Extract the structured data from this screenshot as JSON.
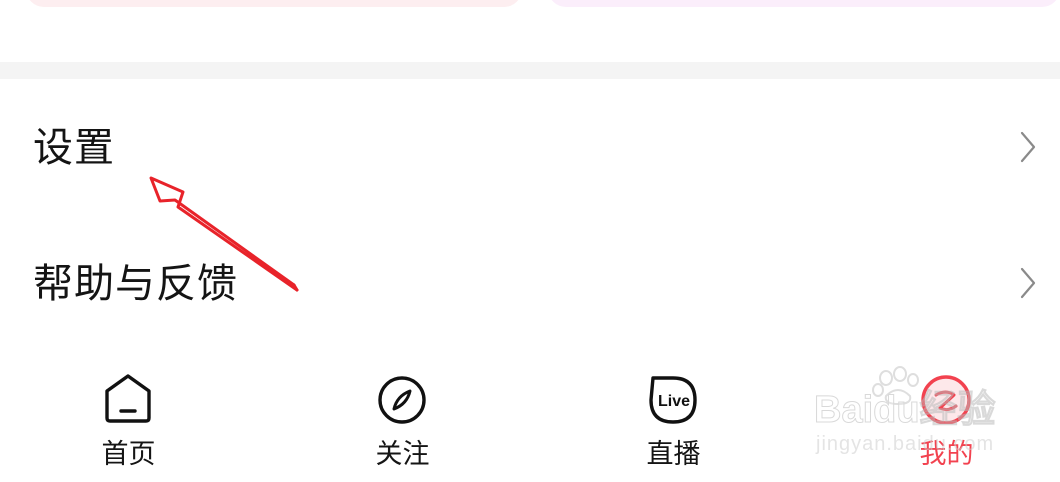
{
  "menu": {
    "items": [
      {
        "label": "设置"
      },
      {
        "label": "帮助与反馈"
      }
    ]
  },
  "tabbar": {
    "tabs": [
      {
        "label": "首页",
        "icon": "home-icon",
        "active": false
      },
      {
        "label": "关注",
        "icon": "compass-icon",
        "active": false
      },
      {
        "label": "直播",
        "icon": "live-icon",
        "active": false
      },
      {
        "label": "我的",
        "icon": "profile-icon",
        "active": true
      }
    ],
    "live_icon_text": "Live"
  },
  "watermark": {
    "main": "Baidu经验",
    "sub": "jingyan.baidu.com"
  },
  "colors": {
    "accent": "#f2424f",
    "annotation": "#e8232a",
    "divider": "#f4f4f4"
  }
}
